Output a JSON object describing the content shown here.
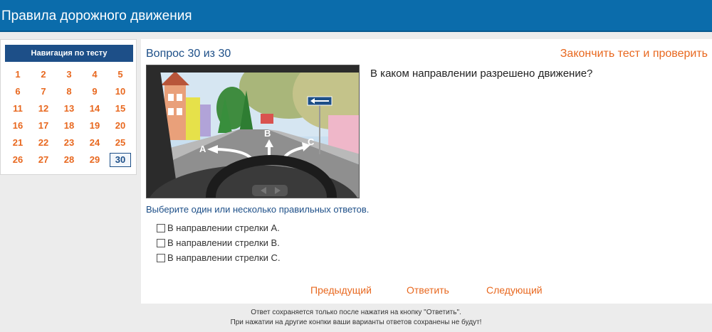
{
  "header": {
    "title": "Правила дорожного движения"
  },
  "nav": {
    "title": "Навигация по тесту",
    "items": [
      "1",
      "2",
      "3",
      "4",
      "5",
      "6",
      "7",
      "8",
      "9",
      "10",
      "11",
      "12",
      "13",
      "14",
      "15",
      "16",
      "17",
      "18",
      "19",
      "20",
      "21",
      "22",
      "23",
      "24",
      "25",
      "26",
      "27",
      "28",
      "29",
      "30"
    ],
    "current": "30"
  },
  "main": {
    "question_number": "Вопрос 30 из 30",
    "finish_link": "Закончить тест и проверить",
    "question_text": "В каком направлении разрешено движение?",
    "hint": "Выберите один или несколько правильных ответов.",
    "image_labels": [
      "A",
      "B",
      "C"
    ],
    "answers": [
      {
        "label": "В направлении стрелки А.",
        "checked": false
      },
      {
        "label": "В направлении стрелки В.",
        "checked": false
      },
      {
        "label": "В направлении стрелки С.",
        "checked": false
      }
    ],
    "buttons": {
      "prev": "Предыдущий",
      "answer": "Ответить",
      "next": "Следующий"
    }
  },
  "footer": {
    "line1": "Ответ сохраняется только после нажатия на кнопку \"Ответить\".",
    "line2": "При нажатии на другие конпки ваши варианты ответов сохранены не будут!"
  },
  "colors": {
    "header": "#0b6cab",
    "nav_head": "#1d4f88",
    "accent": "#e8681f",
    "link_blue": "#1d4f88"
  }
}
